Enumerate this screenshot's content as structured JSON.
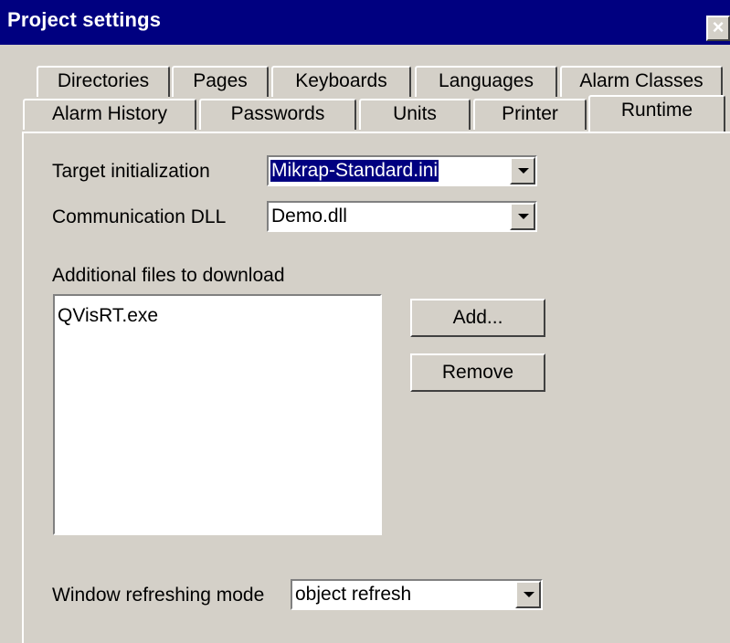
{
  "window": {
    "title": "Project settings",
    "close_glyph": "×"
  },
  "tabs": {
    "row1": [
      "Directories",
      "Pages",
      "Keyboards",
      "Languages",
      "Alarm Classes"
    ],
    "row2": [
      "Alarm History",
      "Passwords",
      "Units",
      "Printer",
      "Runtime"
    ],
    "active": "Runtime"
  },
  "runtime": {
    "target_init_label": "Target initialization",
    "target_init_value": "Mikrap-Standard.ini",
    "comm_dll_label": "Communication DLL",
    "comm_dll_value": "Demo.dll",
    "additional_files_label": "Additional files to download",
    "files": [
      "QVisRT.exe"
    ],
    "add_button": "Add...",
    "remove_button": "Remove",
    "refresh_mode_label": "Window refreshing mode",
    "refresh_mode_value": "object refresh"
  },
  "colors": {
    "title_bar": "#000080",
    "face": "#d4d0c8",
    "selection": "#000080"
  },
  "icons": {
    "close": "close-icon",
    "dropdown": "dropdown-arrow-icon"
  }
}
